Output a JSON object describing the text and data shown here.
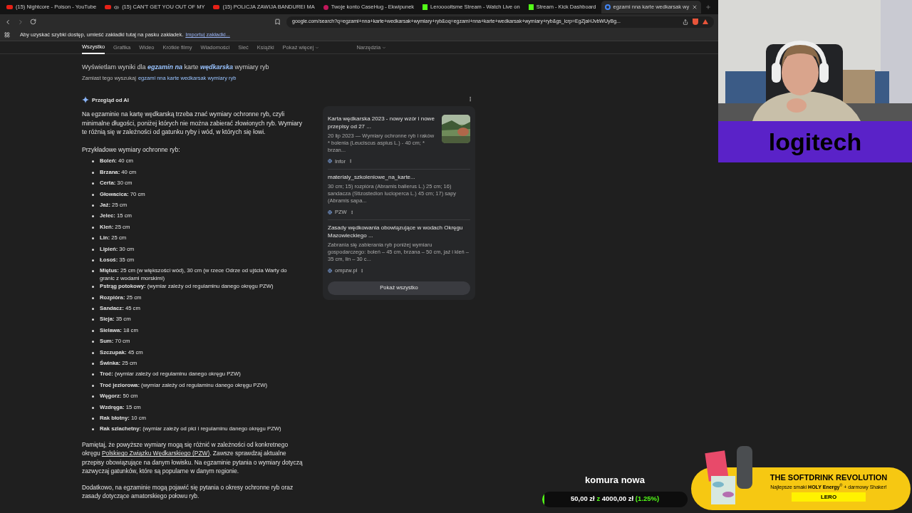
{
  "browser": {
    "tabs": [
      {
        "kind": "youtube",
        "title": "(15) Nightcore - Poison - YouTube",
        "audio": false,
        "selected": false
      },
      {
        "kind": "youtube",
        "title": "(15) CAN'T GET YOU OUT OF MY",
        "audio": true,
        "selected": false
      },
      {
        "kind": "youtube",
        "title": "(15) POLICJA ZAWIJA BANDUREI MA",
        "audio": false,
        "selected": false
      },
      {
        "kind": "casehug",
        "title": "Twoje konto CaseHug - Ekwipunek",
        "audio": false,
        "selected": false
      },
      {
        "kind": "kick",
        "title": "Lerooooitsme Stream - Watch Live on",
        "audio": false,
        "selected": false
      },
      {
        "kind": "kick",
        "title": "Stream - Kick Dashboard",
        "audio": false,
        "selected": false
      },
      {
        "kind": "google",
        "title": "egzami nna karte wedkarsak wy",
        "audio": false,
        "selected": true
      }
    ],
    "address": "google.com/search?q=egzami+nna+karte+wedkarsak+wymiary+ryb&oq=egzami+nna+karte+wedkarsak+wymiary+ryb&gs_lcrp=EgZjaHJvbWUyBg...",
    "bookmarks_bar": {
      "text": "Aby uzyskać szybki dostęp, umieść zakładki tutaj na pasku zakładek.",
      "link": "Importuj zakładki..."
    },
    "search_tabs": [
      {
        "label": "Wszystko",
        "selected": true,
        "menu": false
      },
      {
        "label": "Grafika",
        "selected": false,
        "menu": false
      },
      {
        "label": "Wideo",
        "selected": false,
        "menu": false
      },
      {
        "label": "Krótkie filmy",
        "selected": false,
        "menu": false
      },
      {
        "label": "Wiadomości",
        "selected": false,
        "menu": false
      },
      {
        "label": "Sieć",
        "selected": false,
        "menu": false
      },
      {
        "label": "Książki",
        "selected": false,
        "menu": false
      },
      {
        "label": "Pokaż więcej",
        "selected": false,
        "menu": true
      }
    ],
    "tools": "Narzędzia",
    "correction": {
      "text": "Wyświetlam wyniki dla **egzamin na** karte **wędkarska** wymiary ryb",
      "alt_prefix": "Zamiast tego wyszukaj",
      "alt_link": "egzami nna karte wedkarsak wymiary ryb"
    },
    "ai_overview": {
      "header": "Przegląd od AI",
      "intro": "Na egzaminie na kartę wędkarską trzeba znać wymiary ochronne ryb, czyli minimalne długości, poniżej których nie można zabierać złowionych ryb. Wymiary te różnią się w zależności od gatunku ryby i wód, w których się łowi.",
      "list_title": "Przykładowe wymiary ochronne ryb:",
      "items": [
        {
          "term": "Boleń:",
          "value": "40 cm"
        },
        {
          "term": "Brzana:",
          "value": "40 cm"
        },
        {
          "term": "Certa:",
          "value": "30 cm"
        },
        {
          "term": "Głowacica:",
          "value": "70 cm"
        },
        {
          "term": "Jaź:",
          "value": "25 cm"
        },
        {
          "term": "Jelec:",
          "value": "15 cm"
        },
        {
          "term": "Kleń:",
          "value": "25 cm"
        },
        {
          "term": "Lin:",
          "value": "25 cm"
        },
        {
          "term": "Lipień:",
          "value": "30 cm"
        },
        {
          "term": "Łosoś:",
          "value": "35 cm"
        },
        {
          "term": "Miętus:",
          "value": "25 cm (w większości wód), 30 cm (w rzece Odrze od ujścia Warty do granic z wodami morskimi)"
        },
        {
          "term": "Pstrąg potokowy:",
          "value": "(wymiar zależy od regulaminu danego okręgu PZW)"
        },
        {
          "term": "Rozpióra:",
          "value": "25 cm"
        },
        {
          "term": "Sandacz:",
          "value": "45 cm"
        },
        {
          "term": "Sieja:",
          "value": "35 cm"
        },
        {
          "term": "Sielawa:",
          "value": "18 cm"
        },
        {
          "term": "Sum:",
          "value": "70 cm"
        },
        {
          "term": "Szczupak:",
          "value": "45 cm"
        },
        {
          "term": "Świnka:",
          "value": "25 cm"
        },
        {
          "term": "Troć:",
          "value": "(wymiar zależy od regulaminu danego okręgu PZW)"
        },
        {
          "term": "Troć jeziorowa:",
          "value": "(wymiar zależy od regulaminu danego okręgu PZW)"
        },
        {
          "term": "Węgorz:",
          "value": "50 cm"
        },
        {
          "term": "Wzdręga:",
          "value": "15 cm"
        },
        {
          "term": "Rak błotny:",
          "value": "10 cm"
        },
        {
          "term": "Rak szlachetny:",
          "value": "(wymiar zależy od płci i regulaminu danego okręgu PZW)"
        }
      ],
      "para1_before": "Pamiętaj, że powyższe wymiary mogą się różnić w zależności od konkretnego okręgu",
      "para1_link": "Polskiego Związku Wędkarskiego (PZW)",
      "para1_after": ". Zawsze sprawdzaj aktualne przepisy obowiązujące na danym łowisku. Na egzaminie pytania o wymiary dotyczą zazwyczaj gatunków, które są popularne w danym regionie.",
      "para2": "Dodatkowo, na egzaminie mogą pojawić się pytania o okresy ochronne ryb oraz zasady dotyczące amatorskiego połowu ryb.",
      "sources": [
        {
          "title": "Karta wędkarska 2023 - nowy wzór i nowe przepisy od 27 ...",
          "snippet": "20 lip 2023 — Wymiary ochronne ryb i raków * bolenia (Leuciscus aspius L.) - 40 cm; * brzan...",
          "site": "Infor",
          "thumbnail": true
        },
        {
          "title": "materialy_szkoleniowe_na_karte...",
          "snippet": "30 cm; 15) rozpióra (Abramis ballerus L.) 25 cm; 16) sandacza (Stizostedion lucioperca L.) 45 cm; 17) sapy (Abramis sapa...",
          "site": "PZW",
          "thumbnail": false
        },
        {
          "title": "Zasady wędkowania obowiązujące w wodach Okręgu Mazowieckiego ...",
          "snippet": "Zabrania się zabierania ryb poniżej wymiaru gospodarczego: boleń – 45 cm, brzana – 50 cm, jaź i kleń – 35 cm, lin – 30 c...",
          "site": "ompzw.pl",
          "thumbnail": false
        }
      ],
      "show_all": "Pokaż wszystko"
    }
  },
  "stream": {
    "banner": "logitech",
    "goal": {
      "title": "komura nowa",
      "current": "50,00 zł",
      "separator": "z",
      "target": "4000,00 zł",
      "percent": "(1.25%)",
      "level": 0.0125
    },
    "ad": {
      "headline": "THE SOFTDRINK REVOLUTION",
      "subline": "Najlepsze smaki **HOLY Energy**$^{®}$ + darmowy Shaker!",
      "code": "LERO"
    }
  }
}
